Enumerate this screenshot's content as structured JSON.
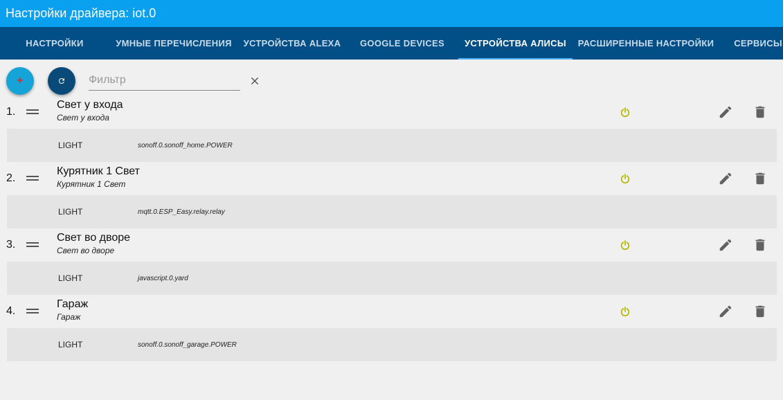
{
  "window": {
    "title": "Настройки драйвера: iot.0"
  },
  "tabs": [
    {
      "label": "НАСТРОЙКИ"
    },
    {
      "label": "УМНЫЕ ПЕРЕЧИСЛЕНИЯ"
    },
    {
      "label": "УСТРОЙСТВА ALEXA"
    },
    {
      "label": "GOOGLE DEVICES"
    },
    {
      "label": "УСТРОЙСТВА АЛИСЫ"
    },
    {
      "label": "РАСШИРЕННЫЕ НАСТРОЙКИ"
    },
    {
      "label": "СЕРВИСЫ I"
    }
  ],
  "active_tab": "УСТРОЙСТВА АЛИСЫ",
  "toolbar": {
    "add_label": "+",
    "filter_placeholder": "Фильтр",
    "filter_value": ""
  },
  "colors": {
    "titlebar": "#0aa0f0",
    "tabbar": "#024e87",
    "power_icon": "#b5b800",
    "action_icon": "#616161"
  },
  "devices": [
    {
      "num": "1.",
      "name": "Свет у входа",
      "desc": "Свет у входа",
      "type": "LIGHT",
      "id": "sonoff.0.sonoff_home.POWER"
    },
    {
      "num": "2.",
      "name": "Курятник 1 Свет",
      "desc": "Курятник 1 Свет",
      "type": "LIGHT",
      "id": "mqtt.0.ESP_Easy.relay.relay"
    },
    {
      "num": "3.",
      "name": "Свет во дворе",
      "desc": "Свет во дворе",
      "type": "LIGHT",
      "id": "javascript.0.yard"
    },
    {
      "num": "4.",
      "name": "Гараж",
      "desc": "Гараж",
      "type": "LIGHT",
      "id": "sonoff.0.sonoff_garage.POWER"
    }
  ],
  "icons": {
    "add": "plus-icon",
    "refresh": "refresh-icon",
    "clear": "close-icon",
    "drag": "drag-handle-icon",
    "power": "power-icon",
    "edit": "pencil-icon",
    "delete": "trash-icon"
  }
}
